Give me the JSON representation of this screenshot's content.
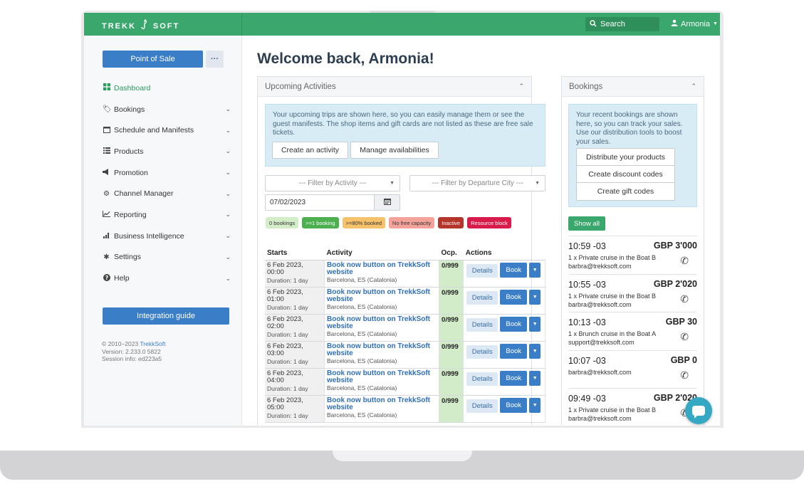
{
  "app": {
    "brand": "TREKK",
    "brand_suffix": "SOFT"
  },
  "topbar": {
    "search_label": "Search",
    "user_name": "Armonia"
  },
  "sidebar": {
    "pos_label": "Point of Sale",
    "more_label": "···",
    "items": [
      {
        "label": "Dashboard",
        "icon": "dashboard-icon"
      },
      {
        "label": "Bookings",
        "icon": "tag-icon"
      },
      {
        "label": "Schedule and Manifests",
        "icon": "calendar-icon"
      },
      {
        "label": "Products",
        "icon": "list-icon"
      },
      {
        "label": "Promotion",
        "icon": "megaphone-icon"
      },
      {
        "label": "Channel Manager",
        "icon": "gear-icon"
      },
      {
        "label": "Reporting",
        "icon": "line-chart-icon"
      },
      {
        "label": "Business Intelligence",
        "icon": "bar-chart-icon"
      },
      {
        "label": "Settings",
        "icon": "cog-icon"
      },
      {
        "label": "Help",
        "icon": "help-icon"
      }
    ],
    "guide_label": "Integration guide",
    "footer": {
      "copyright_prefix": "© 2010–2023 ",
      "copyright_link": "TrekkSoft",
      "version": "Version: 2.233.0 5822",
      "session": "Session info: ed223a5"
    }
  },
  "main": {
    "welcome": "Welcome back, Armonia!",
    "upcoming": {
      "title": "Upcoming Activities",
      "info": "Your upcoming trips are shown here, so you can easily manage them or see the guest manifests. The shop items and gift cards are not listed as these are free sale tickets.",
      "create_label": "Create an activity",
      "manage_label": "Manage availabilities",
      "filter_activity": "--- Filter by Activity ---",
      "filter_city": "--- Filter by Departure City ---",
      "date_value": "07/02/2023",
      "legend": [
        {
          "label": "0 bookings",
          "bg": "#d4edc9",
          "fg": "#333333"
        },
        {
          "label": ">=1 booking",
          "bg": "#4caf50",
          "fg": "#ffffff"
        },
        {
          "label": ">=80% booked",
          "bg": "#f6c26b",
          "fg": "#333333"
        },
        {
          "label": "No free capacity",
          "bg": "#f3a39a",
          "fg": "#333333"
        },
        {
          "label": "Inactive",
          "bg": "#b5352b",
          "fg": "#ffffff"
        },
        {
          "label": "Resource block",
          "bg": "#d81b4a",
          "fg": "#ffffff"
        }
      ],
      "columns": [
        "Starts",
        "Activity",
        "Ocp.",
        "Actions"
      ],
      "details_label": "Details",
      "book_label": "Book",
      "rows": [
        {
          "date": "6 Feb 2023,",
          "time": "00:00",
          "duration": "Duration: 1 day",
          "activity": "Book now button on TrekkSoft website",
          "location": "Barcelona, ES (Catalonia)",
          "ocp": "0/999"
        },
        {
          "date": "6 Feb 2023,",
          "time": "01:00",
          "duration": "Duration: 1 day",
          "activity": "Book now button on TrekkSoft website",
          "location": "Barcelona, ES (Catalonia)",
          "ocp": "0/999"
        },
        {
          "date": "6 Feb 2023,",
          "time": "02:00",
          "duration": "Duration: 1 day",
          "activity": "Book now button on TrekkSoft website",
          "location": "Barcelona, ES (Catalonia)",
          "ocp": "0/999"
        },
        {
          "date": "6 Feb 2023,",
          "time": "03:00",
          "duration": "Duration: 1 day",
          "activity": "Book now button on TrekkSoft website",
          "location": "Barcelona, ES (Catalonia)",
          "ocp": "0/999"
        },
        {
          "date": "6 Feb 2023,",
          "time": "04:00",
          "duration": "Duration: 1 day",
          "activity": "Book now button on TrekkSoft website",
          "location": "Barcelona, ES (Catalonia)",
          "ocp": "0/999"
        },
        {
          "date": "6 Feb 2023,",
          "time": "05:00",
          "duration": "Duration: 1 day",
          "activity": "Book now button on TrekkSoft website",
          "location": "Barcelona, ES (Catalonia)",
          "ocp": "0/999"
        }
      ]
    },
    "bookings": {
      "title": "Bookings",
      "info": "Your recent bookings are shown here, so you can track your sales. Use our distribution tools to boost your sales.",
      "buttons": [
        "Distribute your products",
        "Create discount codes",
        "Create gift codes"
      ],
      "show_all": "Show all",
      "items": [
        {
          "time": "10:59 -03",
          "amount": "GBP 3'000",
          "line1": "1 x Private cruise in the Boat B",
          "line2": "barbra@trekksoft.com"
        },
        {
          "time": "10:55 -03",
          "amount": "GBP 2'020",
          "line1": "1 x Private cruise in the Boat B",
          "line2": "barbra@trekksoft.com"
        },
        {
          "time": "10:13 -03",
          "amount": "GBP 30",
          "line1": "1 x Brunch cruise in the Boat A",
          "line2": "support@trekksoft.com"
        },
        {
          "time": "10:07 -03",
          "amount": "GBP 0",
          "line1": "barbra@trekksoft.com",
          "line2": ""
        },
        {
          "time": "09:49 -03",
          "amount": "GBP 2'020",
          "line1": "1 x Private cruise in the Boat B",
          "line2": "barbra@trekksoft.com"
        }
      ]
    }
  },
  "colors": {
    "brand_green": "#3aa76d",
    "primary_blue": "#3b7ec8",
    "chat": "#35a8c4"
  }
}
